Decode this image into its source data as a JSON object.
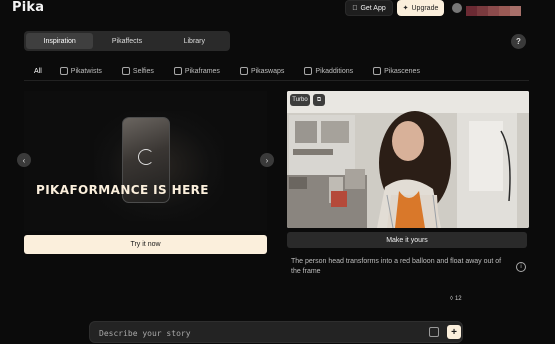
{
  "app": {
    "logo": "Pika"
  },
  "header": {
    "get_app_label": "Get App",
    "upgrade_label": "Upgrade",
    "avatar_strip_colors": [
      "#6b2a33",
      "#7a3a3e",
      "#8c4b4c",
      "#9a5a55",
      "#a8706a"
    ]
  },
  "segmented": [
    {
      "label": "Inspiration",
      "active": true
    },
    {
      "label": "Pikaffects",
      "active": false
    },
    {
      "label": "Library",
      "active": false
    }
  ],
  "help_label": "?",
  "filters": [
    {
      "label": "All",
      "icon": "none",
      "active": true
    },
    {
      "label": "Pikatwists",
      "icon": "twist-icon",
      "active": false
    },
    {
      "label": "Selfies",
      "icon": "selfie-icon",
      "active": false
    },
    {
      "label": "Pikaframes",
      "icon": "frames-icon",
      "active": false
    },
    {
      "label": "Pikaswaps",
      "icon": "swap-icon",
      "active": false
    },
    {
      "label": "Pikadditions",
      "icon": "additions-icon",
      "active": false
    },
    {
      "label": "Pikascenes",
      "icon": "scenes-icon",
      "active": false
    }
  ],
  "featured": {
    "title": "PIKAFORMANCE IS HERE",
    "cta": "Try it now",
    "prev_arrow": "‹",
    "next_arrow": "›"
  },
  "example": {
    "badge_turbo": "Turbo",
    "make_label": "Make it yours",
    "description": "The person head transforms into a red balloon and float away out of the frame",
    "info_label": "i",
    "likes": "12"
  },
  "prompt": {
    "placeholder": "Describe your story",
    "value": "",
    "send_label": "+"
  },
  "colors": {
    "background": "#0b0b0b",
    "cream": "#fbefdc",
    "panel": "#2a2a2a"
  }
}
